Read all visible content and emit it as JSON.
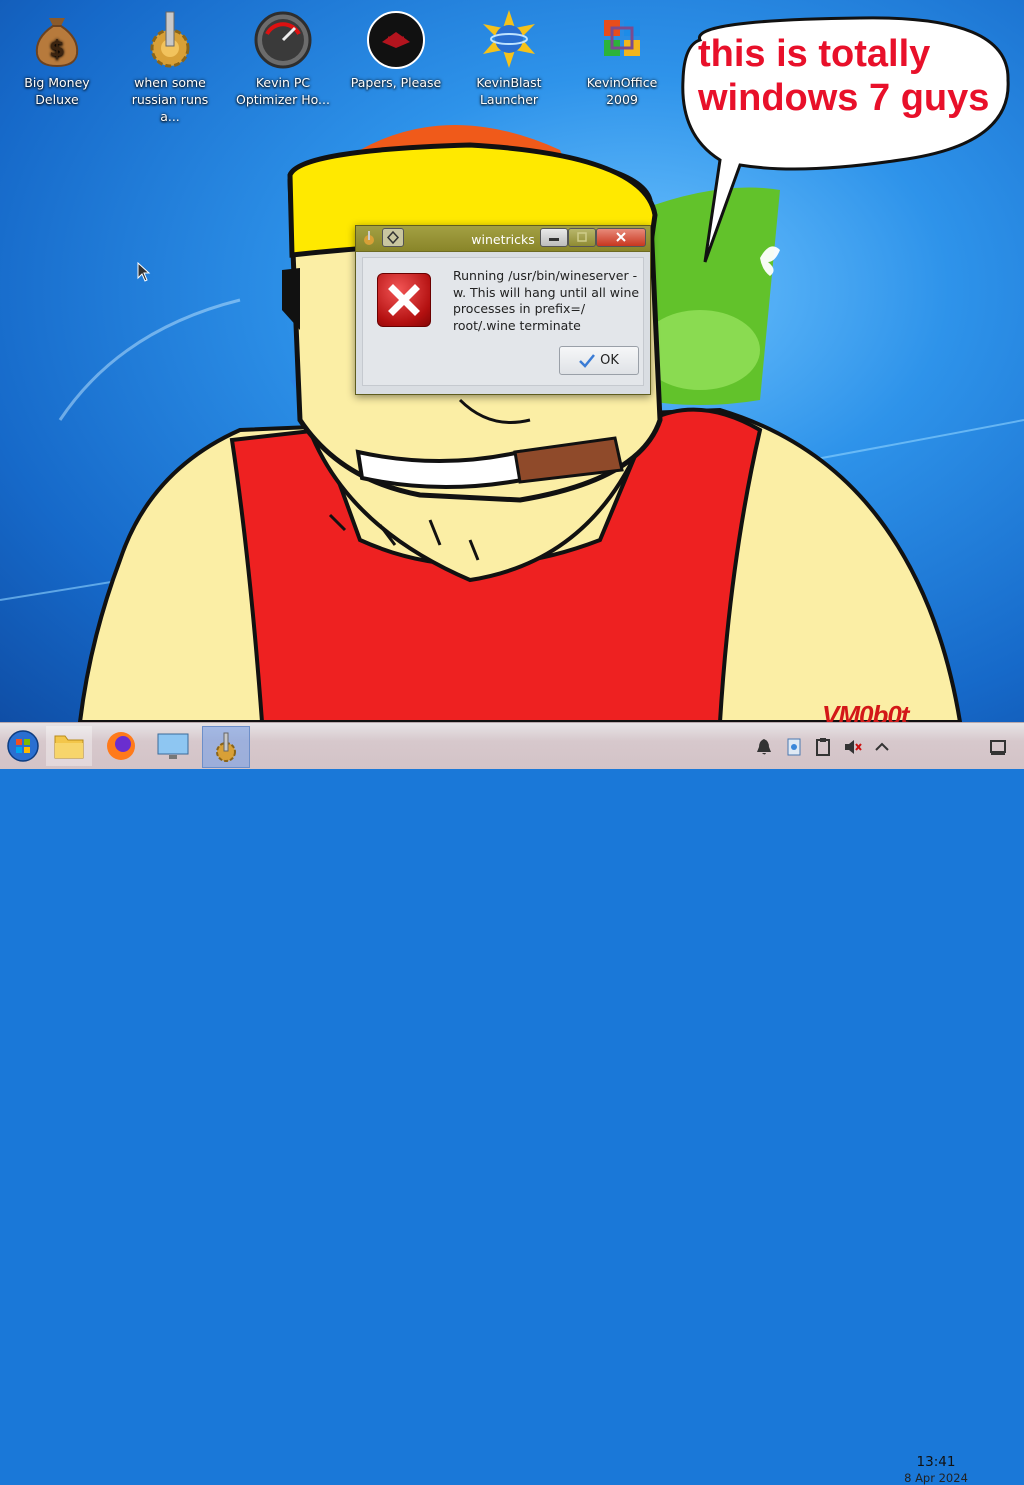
{
  "desktop": {
    "icons": [
      {
        "label": "Big Money Deluxe",
        "icon": "money-bag-icon"
      },
      {
        "label": "when some russian runs a...",
        "icon": "gear-icon"
      },
      {
        "label": "Kevin PC Optimizer Ho...",
        "icon": "speedometer-icon"
      },
      {
        "label": "Papers, Please",
        "icon": "emblem-icon"
      },
      {
        "label": "KevinBlast Launcher",
        "icon": "starburst-icon"
      },
      {
        "label": "KevinOffice 2009",
        "icon": "office-logo-icon"
      }
    ],
    "speech_bubble": "this is totally windows 7 guys",
    "watermark": "VM0b0t"
  },
  "dialog": {
    "title": "winetricks",
    "message": "Running /usr/bin/wineserver -w. This will hang until all wine processes in prefix=/ root/.wine terminate",
    "ok_label": "OK"
  },
  "taskbar": {
    "clock_time": "13:41",
    "clock_date": "8 Apr 2024"
  },
  "colors": {
    "bubble_text": "#e8102a",
    "dialog_titlebar": "#9a9638",
    "taskbar": "#d7c8cc"
  }
}
